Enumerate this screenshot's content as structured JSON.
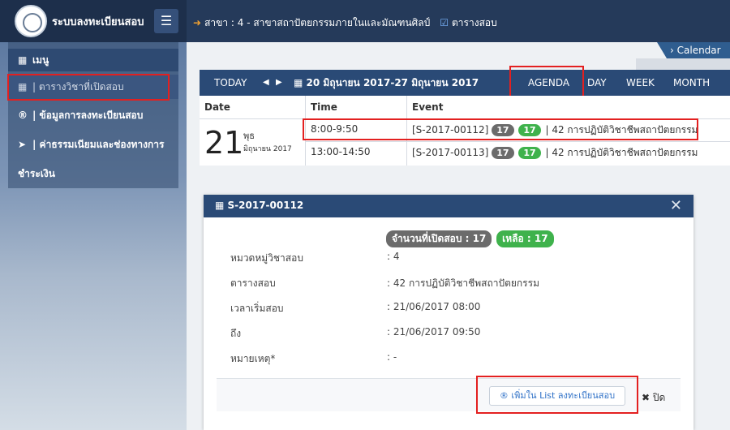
{
  "app": {
    "title": "ระบบลงทะเบียนสอบ"
  },
  "header": {
    "breadcrumb": "สาขา : 4 - สาขาสถาปัตยกรรมภายในและมัณฑนศิลป์",
    "schedule_link": "ตารางสอบ"
  },
  "sidebar": {
    "items": [
      {
        "label": "เมนู"
      },
      {
        "label": "| ตารางวิชาที่เปิดสอบ"
      },
      {
        "label": "| ข้อมูลการลงทะเบียนสอบ"
      },
      {
        "label": "| ค่าธรรมเนียมและช่องทางการ"
      },
      {
        "label": "ชำระเงิน"
      }
    ]
  },
  "calendar": {
    "tab_label": "Calendar",
    "toolbar": {
      "today": "TODAY",
      "date_range": "20 มิถุนายน 2017-27 มิถุนายน 2017",
      "views": [
        "AGENDA",
        "DAY",
        "WEEK",
        "MONTH"
      ],
      "active_view": "AGENDA"
    },
    "columns": [
      "Date",
      "Time",
      "Event"
    ],
    "day": {
      "number": "21",
      "weekday": "พุธ",
      "month": "มิถุนายน 2017"
    },
    "events": [
      {
        "time": "8:00-9:50",
        "code": "[S-2017-00112]",
        "open": "17",
        "remaining": "17",
        "title": "| 42 การปฏิบัติวิชาชีพสถาปัตยกรรม"
      },
      {
        "time": "13:00-14:50",
        "code": "[S-2017-00113]",
        "open": "17",
        "remaining": "17",
        "title": "| 42 การปฏิบัติวิชาชีพสถาปัตยกรรม"
      }
    ]
  },
  "modal": {
    "title": "S-2017-00112",
    "badge_open": "จำนวนที่เปิดสอบ : 17",
    "badge_remaining": "เหลือ : 17",
    "rows": [
      {
        "label": "หมวดหมู่วิชาสอบ",
        "value": ": 4"
      },
      {
        "label": "ตารางสอบ",
        "value": ": 42 การปฏิบัติวิชาชีพสถาปัตยกรรม"
      },
      {
        "label": "เวลาเริ่มสอบ",
        "value": ": 21/06/2017 08:00"
      },
      {
        "label": "ถึง",
        "value": ": 21/06/2017 09:50"
      },
      {
        "label": "หมายเหตุ*",
        "value": ": -"
      }
    ],
    "add_button": "เพิ่มใน List ลงทะเบียนสอบ",
    "close_button": "ปิด"
  }
}
